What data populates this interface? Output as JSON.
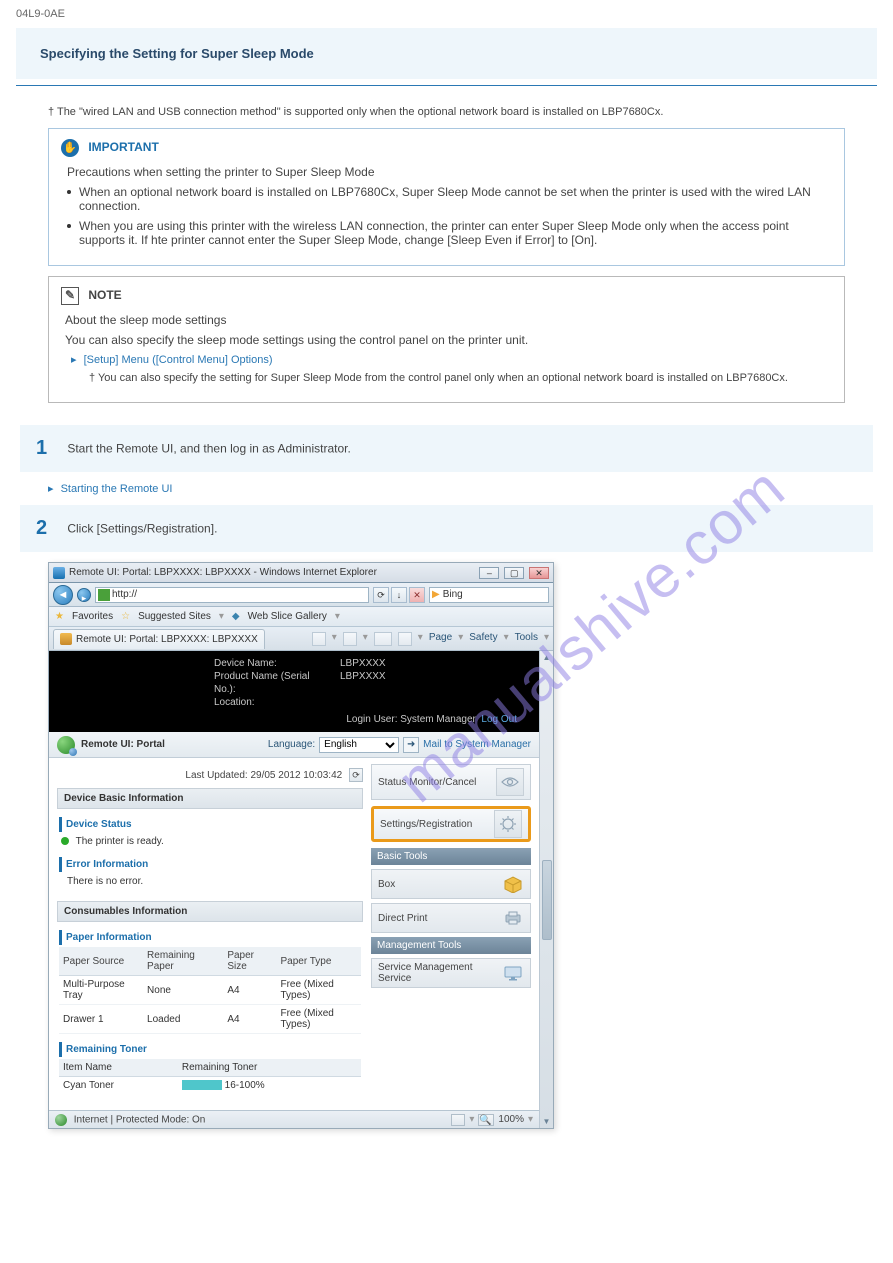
{
  "page_id": "04L9-0AE",
  "section_title": "Specifying the Setting for Super Sleep Mode",
  "dagger_text": "† The \"wired LAN and USB connection method\" is supported only when the optional network board is installed on LBP7680Cx.",
  "important": {
    "heading": "IMPORTANT",
    "line1": "Precautions when setting the printer to Super Sleep Mode",
    "bullet1": "When an optional network board is installed on LBP7680Cx, Super Sleep Mode cannot be set when the printer is used with the wired LAN connection.",
    "bullet2": "When you are using this printer with the wireless LAN connection, the printer can enter Super Sleep Mode only when the access point supports it. If hte printer cannot enter the Super Sleep Mode, change [Sleep Even if Error] to [On]."
  },
  "note": {
    "heading": "NOTE",
    "line1": "About the sleep mode settings",
    "line2": "You can also specify the sleep mode settings using the control panel on the printer unit.",
    "link": "[Setup] Menu ([Control Menu] Options)",
    "inner_dagger": "† You can also specify the setting for Super Sleep Mode from the control panel only when an optional network board is installed on LBP7680Cx."
  },
  "steps": {
    "s1": {
      "num": "1",
      "text": "Start the Remote UI, and then log in as Administrator."
    },
    "s1_link": "Starting the Remote UI",
    "s2": {
      "num": "2",
      "text": "Click [Settings/Registration]."
    }
  },
  "watermark": "manualshive.com",
  "window": {
    "title": "Remote UI: Portal: LBPXXXX: LBPXXXX - Windows Internet Explorer",
    "addr_prefix": "http://",
    "search_engine": "Bing",
    "fav_label": "Favorites",
    "fav_item1": "Suggested Sites",
    "fav_item2": "Web Slice Gallery",
    "tab_title": "Remote UI: Portal: LBPXXXX: LBPXXXX",
    "menus": {
      "page": "Page",
      "safety": "Safety",
      "tools": "Tools"
    },
    "black": {
      "device_name_lbl": "Device Name:",
      "device_name_val": "LBPXXXX",
      "product_lbl": "Product Name (Serial No.):",
      "product_val": "LBPXXXX",
      "location_lbl": "Location:",
      "login_text": "Login User: System Manager",
      "logout": "Log Out"
    },
    "portal": {
      "title": "Remote UI: Portal",
      "language_lbl": "Language:",
      "language_val": "English",
      "mail": "Mail to System Manager",
      "last_updated_lbl": "Last Updated:",
      "last_updated_val": "29/05 2012 10:03:42"
    },
    "left": {
      "dbi_title": "Device Basic Information",
      "device_status": "Device Status",
      "ready": "The printer is ready.",
      "error_info": "Error Information",
      "no_error": "There is no error.",
      "consumables": "Consumables Information",
      "paper_info": "Paper Information",
      "paper_headers": [
        "Paper Source",
        "Remaining Paper",
        "Paper Size",
        "Paper Type"
      ],
      "paper_rows": [
        [
          "Multi-Purpose Tray",
          "None",
          "A4",
          "Free (Mixed Types)"
        ],
        [
          "Drawer 1",
          "Loaded",
          "A4",
          "Free (Mixed Types)"
        ]
      ],
      "remaining_toner": "Remaining Toner",
      "toner_headers": [
        "Item Name",
        "Remaining Toner"
      ],
      "toner_row": [
        "Cyan Toner",
        "16-100%"
      ]
    },
    "right": {
      "status_monitor": "Status Monitor/Cancel",
      "settings_reg": "Settings/Registration",
      "basic_tools": "Basic Tools",
      "box": "Box",
      "direct_print": "Direct Print",
      "mgmt_tools": "Management Tools",
      "sms": "Service Management Service"
    },
    "statusbar": {
      "text": "Internet | Protected Mode: On",
      "zoom": "100%"
    }
  }
}
